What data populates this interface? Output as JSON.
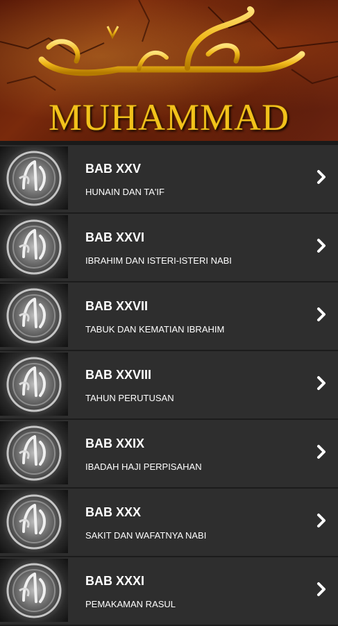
{
  "banner": {
    "title": "MUHAMMAD"
  },
  "colors": {
    "background": "#2b2b2b",
    "row": "#2e2e2e",
    "title_gold": "#f2c21b",
    "text": "#ffffff"
  },
  "icons": {
    "thumbnail": "calligraphy-medallion-icon",
    "chevron": "chevron-right-icon"
  },
  "chapters": [
    {
      "heading": "BAB XXV",
      "subtitle": "HUNAIN DAN TA'IF"
    },
    {
      "heading": "BAB XXVI",
      "subtitle": "IBRAHIM DAN ISTERI-ISTERI NABI"
    },
    {
      "heading": "BAB XXVII",
      "subtitle": "TABUK DAN KEMATIAN IBRAHIM"
    },
    {
      "heading": "BAB XXVIII",
      "subtitle": "TAHUN PERUTUSAN"
    },
    {
      "heading": "BAB XXIX",
      "subtitle": "IBADAH HAJI PERPISAHAN"
    },
    {
      "heading": "BAB XXX",
      "subtitle": "SAKIT DAN WAFATNYA NABI"
    },
    {
      "heading": "BAB XXXI",
      "subtitle": "PEMAKAMAN RASUL"
    }
  ]
}
